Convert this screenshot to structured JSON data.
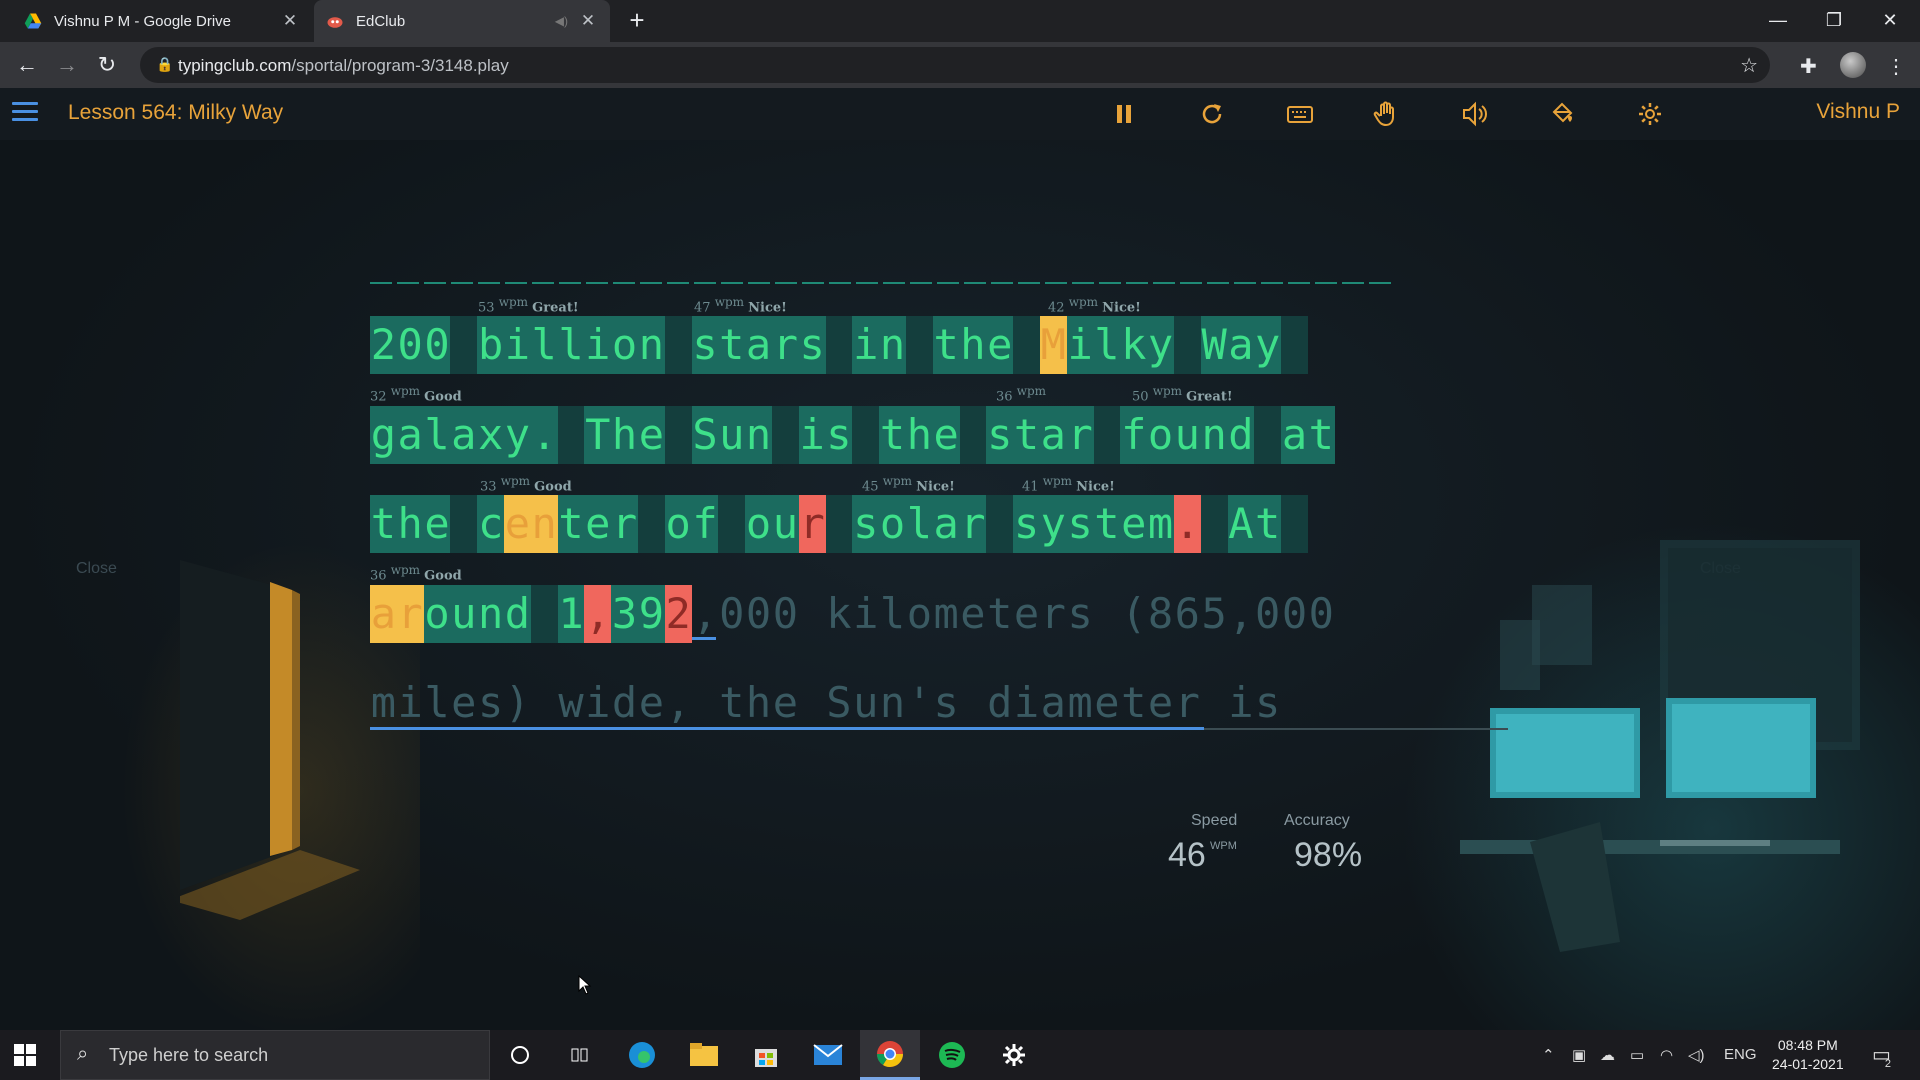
{
  "tabs": [
    {
      "title": "Vishnu P M - Google Drive",
      "active": false,
      "icon": "google-drive-icon"
    },
    {
      "title": "EdClub",
      "active": true,
      "icon": "edclub-icon"
    }
  ],
  "address": {
    "host": "typingclub.com",
    "path": "/sportal/program-3/3148.play"
  },
  "header": {
    "lesson_title": "Lesson 564: Milky Way",
    "user_name": "Vishnu P"
  },
  "typing": {
    "lines": [
      "200 billion stars in the Milky Way ",
      "galaxy. The Sun is the star found at ",
      "the center of our solar system. At ",
      "around 1,392,000 kilometers (865,000 ",
      "miles) wide, the Sun's diameter is"
    ],
    "typed_count": [
      35,
      36,
      35,
      12,
      0
    ],
    "warn": [
      [
        25
      ],
      [],
      [
        5,
        6
      ],
      [
        0,
        1
      ],
      []
    ],
    "errors": [
      [],
      [],
      [
        16,
        30
      ],
      [
        8,
        11
      ],
      []
    ],
    "word_labels": [
      {
        "wpm": "53",
        "rating": "Great!"
      },
      {
        "wpm": "47",
        "rating": "Nice!"
      },
      {
        "wpm": "42",
        "rating": "Nice!"
      },
      {
        "wpm": "32",
        "rating": "Good"
      },
      {
        "wpm": "36",
        "rating": ""
      },
      {
        "wpm": "50",
        "rating": "Great!"
      },
      {
        "wpm": "33",
        "rating": "Good"
      },
      {
        "wpm": "45",
        "rating": "Nice!"
      },
      {
        "wpm": "41",
        "rating": "Nice!"
      },
      {
        "wpm": "36",
        "rating": "Good"
      }
    ],
    "wpm_unit": "wpm"
  },
  "scene": {
    "close_label": "Close"
  },
  "stats": {
    "speed_label": "Speed",
    "speed_value": "46",
    "speed_unit": "WPM",
    "accuracy_label": "Accuracy",
    "accuracy_value": "98%"
  },
  "taskbar": {
    "search_placeholder": "Type here to search",
    "language": "ENG",
    "time": "08:48 PM",
    "date": "24-01-2021",
    "notifications": "2"
  },
  "colors": {
    "accent": "#e8a33a",
    "typed": "#3ee08a",
    "error": "#f0675d",
    "warn": "#f5c04a"
  }
}
